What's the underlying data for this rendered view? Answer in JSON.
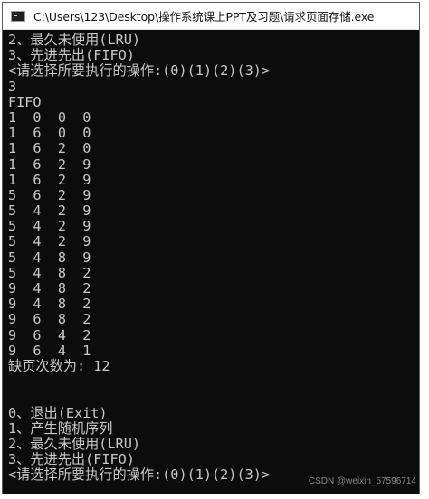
{
  "window": {
    "title": "C:\\Users\\123\\Desktop\\操作系统课上PPT及习题\\请求页面存储.exe",
    "icon": "console-app-icon"
  },
  "console": {
    "lines": [
      "2、最久未使用(LRU)",
      "3、先进先出(FIFO)",
      "<请选择所要执行的操作:(0)(1)(2)(3)>",
      "3",
      "FIFO",
      "1  0  0  0",
      "1  6  0  0",
      "1  6  2  0",
      "1  6  2  9",
      "1  6  2  9",
      "5  6  2  9",
      "5  4  2  9",
      "5  4  2  9",
      "5  4  2  9",
      "5  4  8  9",
      "5  4  8  2",
      "9  4  8  2",
      "9  4  8  2",
      "9  6  8  2",
      "9  6  4  2",
      "9  6  4  1",
      "缺页次数为: 12",
      "",
      "",
      "0、退出(Exit)",
      "1、产生随机序列",
      "2、最久未使用(LRU)",
      "3、先进先出(FIFO)",
      "<请选择所要执行的操作:(0)(1)(2)(3)>"
    ]
  },
  "watermark": "CSDN @weixin_57596714"
}
